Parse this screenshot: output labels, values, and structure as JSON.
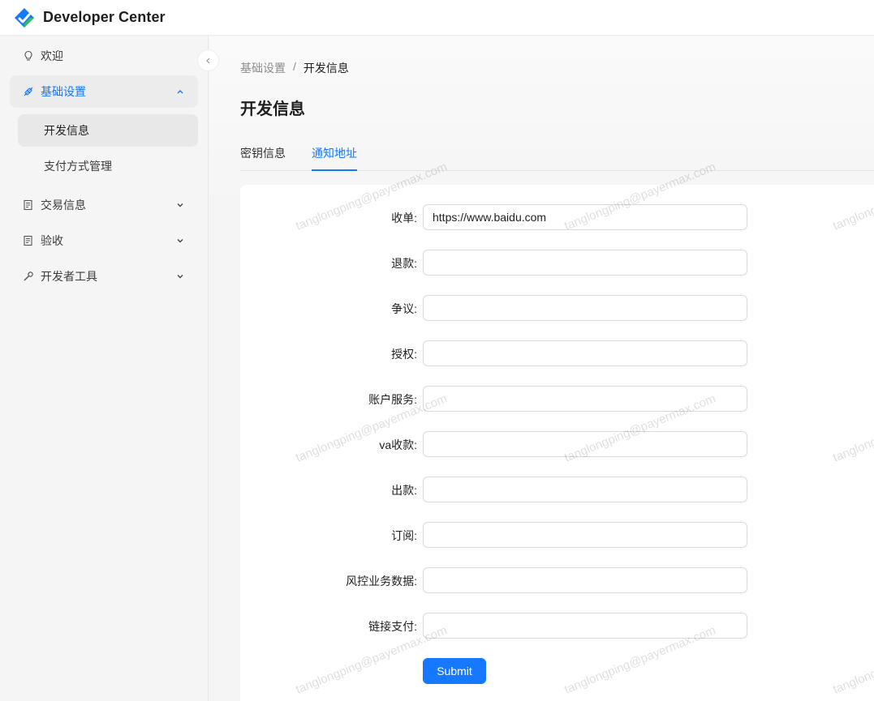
{
  "app": {
    "title": "Developer Center"
  },
  "sidebar": {
    "items": [
      {
        "label": "欢迎",
        "icon": "bulb-icon"
      },
      {
        "label": "基础设置",
        "icon": "link-icon",
        "expanded": true,
        "children": [
          {
            "label": "开发信息",
            "selected": true
          },
          {
            "label": "支付方式管理"
          }
        ]
      },
      {
        "label": "交易信息",
        "icon": "document-icon"
      },
      {
        "label": "验收",
        "icon": "document-icon"
      },
      {
        "label": "开发者工具",
        "icon": "wrench-icon"
      }
    ]
  },
  "breadcrumb": {
    "parent": "基础设置",
    "separator": "/",
    "current": "开发信息"
  },
  "page": {
    "title": "开发信息"
  },
  "tabs": [
    {
      "label": "密钥信息"
    },
    {
      "label": "通知地址",
      "active": true
    }
  ],
  "form": {
    "fields": [
      {
        "label": "收单",
        "value": "https://www.baidu.com"
      },
      {
        "label": "退款",
        "value": ""
      },
      {
        "label": "争议",
        "value": ""
      },
      {
        "label": "授权",
        "value": ""
      },
      {
        "label": "账户服务",
        "value": ""
      },
      {
        "label": "va收款",
        "value": ""
      },
      {
        "label": "出款",
        "value": ""
      },
      {
        "label": "订阅",
        "value": ""
      },
      {
        "label": "风控业务数据",
        "value": ""
      },
      {
        "label": "链接支付",
        "value": ""
      }
    ],
    "label_suffix": ":",
    "submit_label": "Submit"
  },
  "watermark": {
    "text": "tanglongping@payermax.com"
  },
  "colors": {
    "accent": "#1677ff",
    "sidebar_bg": "#f5f5f5",
    "card_bg": "#ffffff"
  }
}
